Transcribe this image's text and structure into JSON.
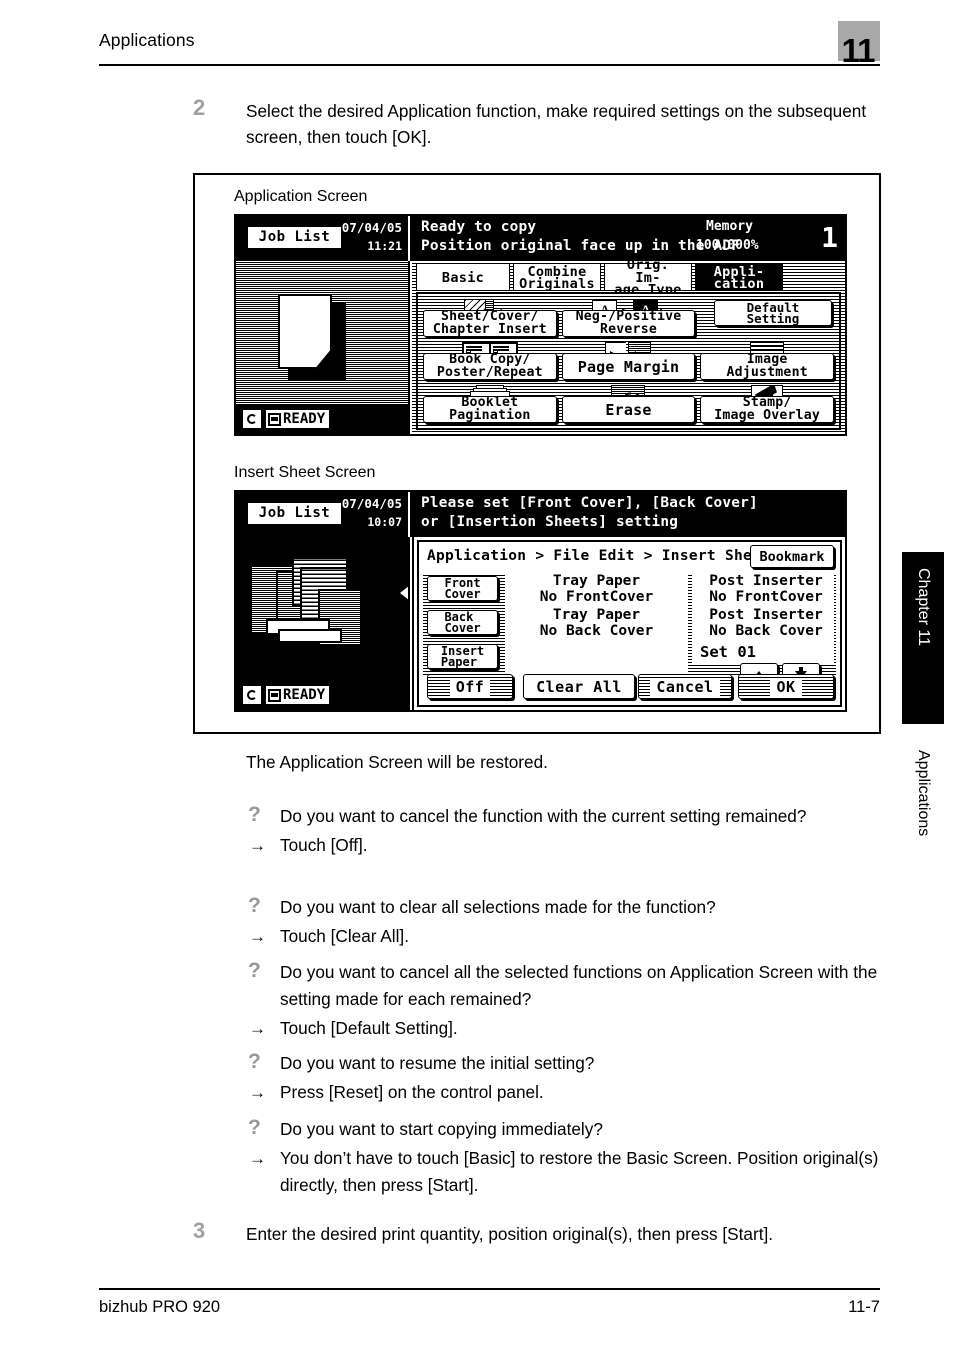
{
  "header": {
    "title": "Applications",
    "chapter_number": "11"
  },
  "steps": {
    "step2": {
      "number": "2",
      "text": "Select the desired Application function, make required settings on the subsequent screen, then touch [OK]."
    },
    "step3": {
      "number": "3",
      "text": "Enter the desired print quantity, position original(s), then press [Start]."
    }
  },
  "figure": {
    "caption_application": "Application Screen",
    "caption_insert": "Insert Sheet Screen",
    "application_screen": {
      "job_list_button": "Job List",
      "date": "07/04/05",
      "time": "11:21",
      "message_line1": "Ready to copy",
      "message_line2": "Position original face up in the ADF",
      "memory_label": "Memory",
      "memory_value": "100.000%",
      "copy_count": "1",
      "ready_status": "READY",
      "tabs": [
        {
          "label": "Basic",
          "selected": false,
          "icon": "tab-basic"
        },
        {
          "label": "Combine\nOriginals",
          "selected": false,
          "icon": "tab-combine-originals"
        },
        {
          "label": "Orig. Im-\nage Type",
          "selected": false,
          "icon": "tab-orig-image-type"
        },
        {
          "label": "Appli-\ncation",
          "selected": true,
          "icon": "tab-application"
        }
      ],
      "default_setting_button": "Default\nSetting",
      "functions": [
        {
          "label": "Sheet/Cover/\nChapter Insert",
          "icon": "sheet-cover-icon"
        },
        {
          "label": "Neg-/Positive\nReverse",
          "icon": "neg-positive-icon"
        },
        {
          "label": "Book Copy/\nPoster/Repeat",
          "icon": "book-copy-icon"
        },
        {
          "label": "Page Margin",
          "icon": "page-margin-icon"
        },
        {
          "label": "Image\nAdjustment",
          "icon": "image-adjustment-icon"
        },
        {
          "label": "Booklet\nPagination",
          "icon": "booklet-pagination-icon"
        },
        {
          "label": "Erase",
          "icon": "erase-icon"
        },
        {
          "label": "Stamp/\nImage Overlay",
          "icon": "stamp-overlay-icon"
        }
      ]
    },
    "insert_screen": {
      "job_list_button": "Job List",
      "date": "07/04/05",
      "time": "10:07",
      "message_line1": "Please set [Front Cover], [Back Cover]",
      "message_line2": "or [Insertion Sheets] setting",
      "ready_status": "READY",
      "breadcrumb": "Application > File Edit > Insert Sheet",
      "bookmark_button": "Bookmark",
      "rows": [
        {
          "button_label": "Front\nCover",
          "middle": "Tray Paper\nNo FrontCover",
          "right": "Post Inserter\nNo FrontCover"
        },
        {
          "button_label": "Back\nCover",
          "middle": "Tray Paper\nNo Back Cover",
          "right": "Post Inserter\nNo Back Cover"
        },
        {
          "button_label": "Insert\nPaper",
          "middle": "",
          "right": ""
        }
      ],
      "set_label": "Set 01",
      "spin_up_icon": "arrow-up-icon",
      "spin_down_icon": "arrow-down-icon",
      "footer_buttons": {
        "off": "Off",
        "clear_all": "Clear All",
        "cancel": "Cancel",
        "ok": "OK"
      }
    }
  },
  "body": {
    "restored_line": "The Application Screen will be restored.",
    "qa": [
      {
        "question": "Do you want to cancel the function with the current setting remained?",
        "answer": "Touch [Off]."
      },
      {
        "question": "Do you want to clear all selections made for the function?",
        "answer": "Touch [Clear All]."
      },
      {
        "question": "Do you want to cancel all the selected functions on Application Screen with the setting made for each remained?",
        "answer": "Touch [Default Setting]."
      },
      {
        "question": "Do you want to resume the initial setting?",
        "answer": "Press [Reset] on the control panel."
      },
      {
        "question": "Do you want to start copying immediately?",
        "answer": "You don’t have to touch [Basic] to restore the Basic Screen. Position original(s) directly, then press [Start]."
      }
    ],
    "question_marker": "?",
    "answer_marker": "→"
  },
  "side_tabs": {
    "chapter": "Chapter 11",
    "section": "Applications"
  },
  "footer": {
    "product": "bizhub PRO 920",
    "page_number": "11-7"
  }
}
